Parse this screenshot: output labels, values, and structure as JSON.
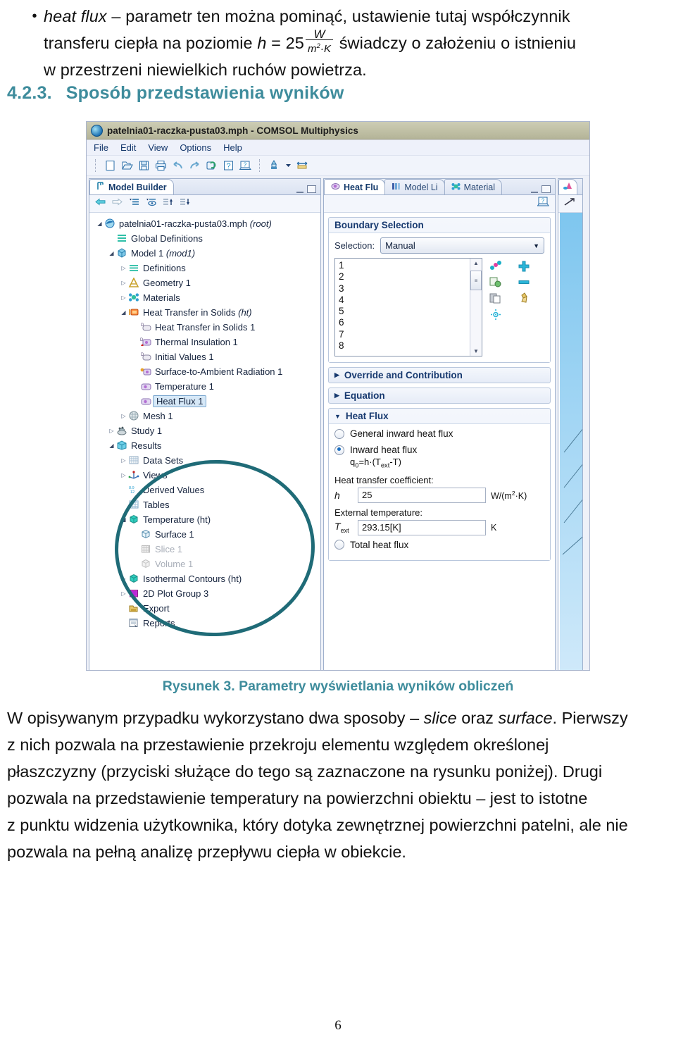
{
  "bullet": {
    "marker": "•",
    "line1_a": "heat flux",
    "line1_b": "– parametr ten można pominąć, ustawienie tutaj współczynnik",
    "line2_pre": "transferu   ciepła   na   poziomie",
    "line2_h": "h",
    "line2_eq": "= 25",
    "frac_num": "W",
    "frac_den_m": "m",
    "frac_den_exp": "2",
    "frac_den_k": "·K",
    "line2_post": "świadczy   o   założeniu   o   istnieniu",
    "line3": "w przestrzeni niewielkich ruchów powietrza."
  },
  "heading": {
    "number": "4.2.3.",
    "text": "Sposób przedstawienia wyników",
    "color": "#3e8c9c"
  },
  "comsol": {
    "title": "patelnia01-raczka-pusta03.mph - COMSOL Multiphysics",
    "menu": [
      "File",
      "Edit",
      "View",
      "Options",
      "Help"
    ],
    "toolbar_icons": [
      "new-icon",
      "open-icon",
      "save-icon",
      "print-icon",
      "undo-icon",
      "redo-icon",
      "refresh-icon",
      "help-icon",
      "help-window-icon",
      "brush-icon",
      "chevron-down-icon",
      "measure-icon"
    ],
    "model_builder": {
      "tab_label": "Model Builder",
      "tool_icons": [
        "back-arrow-icon",
        "forward-arrow-icon",
        "collapse-list-icon",
        "show-hidden-icon",
        "move-up-icon",
        "move-down-icon"
      ],
      "tree": [
        {
          "label": "patelnia01-raczka-pusta03.mph",
          "suffix": "(root)",
          "indent": 0,
          "twisty": "down",
          "icon": "comsol-file-icon"
        },
        {
          "label": "Global Definitions",
          "suffix": "",
          "indent": 1,
          "twisty": "none",
          "icon": "global-definitions-icon"
        },
        {
          "label": "Model 1",
          "suffix": "(mod1)",
          "indent": 1,
          "twisty": "down",
          "icon": "model-icon"
        },
        {
          "label": "Definitions",
          "suffix": "",
          "indent": 2,
          "twisty": "right",
          "icon": "definitions-icon"
        },
        {
          "label": "Geometry 1",
          "suffix": "",
          "indent": 2,
          "twisty": "right",
          "icon": "geometry-icon"
        },
        {
          "label": "Materials",
          "suffix": "",
          "indent": 2,
          "twisty": "right",
          "icon": "materials-icon"
        },
        {
          "label": "Heat Transfer in Solids",
          "suffix": "(ht)",
          "indent": 2,
          "twisty": "down",
          "icon": "heat-transfer-icon"
        },
        {
          "label": "Heat Transfer in Solids 1",
          "suffix": "",
          "indent": 3,
          "twisty": "none",
          "icon": "domain-node-icon"
        },
        {
          "label": "Thermal Insulation 1",
          "suffix": "",
          "indent": 3,
          "twisty": "none",
          "icon": "thermal-insulation-icon"
        },
        {
          "label": "Initial Values 1",
          "suffix": "",
          "indent": 3,
          "twisty": "none",
          "icon": "initial-values-icon"
        },
        {
          "label": "Surface-to-Ambient Radiation 1",
          "suffix": "",
          "indent": 3,
          "twisty": "none",
          "icon": "radiation-icon"
        },
        {
          "label": "Temperature 1",
          "suffix": "",
          "indent": 3,
          "twisty": "none",
          "icon": "temperature-bc-icon"
        },
        {
          "label": "Heat Flux 1",
          "suffix": "",
          "indent": 3,
          "twisty": "none",
          "icon": "heat-flux-icon",
          "selected": true
        },
        {
          "label": "Mesh 1",
          "suffix": "",
          "indent": 2,
          "twisty": "right",
          "icon": "mesh-icon"
        },
        {
          "label": "Study 1",
          "suffix": "",
          "indent": 1,
          "twisty": "right",
          "icon": "study-icon"
        },
        {
          "label": "Results",
          "suffix": "",
          "indent": 1,
          "twisty": "down",
          "icon": "results-icon"
        },
        {
          "label": "Data Sets",
          "suffix": "",
          "indent": 2,
          "twisty": "right",
          "icon": "data-sets-icon"
        },
        {
          "label": "Views",
          "suffix": "",
          "indent": 2,
          "twisty": "right",
          "icon": "views-icon"
        },
        {
          "label": "Derived Values",
          "suffix": "",
          "indent": 2,
          "twisty": "none",
          "icon": "derived-values-icon"
        },
        {
          "label": "Tables",
          "suffix": "",
          "indent": 2,
          "twisty": "none",
          "icon": "tables-icon"
        },
        {
          "label": "Temperature (ht)",
          "suffix": "",
          "indent": 2,
          "twisty": "down",
          "icon": "plot-group-icon"
        },
        {
          "label": "Surface 1",
          "suffix": "",
          "indent": 3,
          "twisty": "none",
          "icon": "surface-plot-icon"
        },
        {
          "label": "Slice 1",
          "suffix": "",
          "indent": 3,
          "twisty": "none",
          "icon": "slice-plot-icon",
          "dim": true
        },
        {
          "label": "Volume 1",
          "suffix": "",
          "indent": 3,
          "twisty": "none",
          "icon": "volume-plot-icon",
          "dim": true
        },
        {
          "label": "Isothermal Contours (ht)",
          "suffix": "",
          "indent": 2,
          "twisty": "right",
          "icon": "plot-group-icon"
        },
        {
          "label": "2D Plot Group 3",
          "suffix": "",
          "indent": 2,
          "twisty": "right",
          "icon": "plot-group-2d-icon"
        },
        {
          "label": "Export",
          "suffix": "",
          "indent": 2,
          "twisty": "none",
          "icon": "export-icon"
        },
        {
          "label": "Reports",
          "suffix": "",
          "indent": 2,
          "twisty": "none",
          "icon": "reports-icon"
        }
      ]
    },
    "settings": {
      "tabs": [
        {
          "label": "Heat Flu",
          "icon": "heat-flux-icon",
          "active": true
        },
        {
          "label": "Model Li",
          "icon": "model-library-icon",
          "active": false
        },
        {
          "label": "Material",
          "icon": "materials-icon",
          "active": false
        }
      ],
      "boundary_selection": {
        "title": "Boundary Selection",
        "selection_label": "Selection:",
        "selection_value": "Manual",
        "list_items": [
          "1",
          "2",
          "3",
          "4",
          "5",
          "6",
          "7",
          "8"
        ],
        "side_icons": [
          "active-selection-icon",
          "add-icon",
          "paste-copy-icon",
          "remove-icon",
          "paste-icon",
          "clear-icon",
          "zoom-selection-icon"
        ]
      },
      "override": {
        "title": "Override and Contribution"
      },
      "equation": {
        "title": "Equation"
      },
      "heat_flux": {
        "title": "Heat Flux",
        "opt_general": "General inward heat flux",
        "opt_inward": "Inward heat flux",
        "opt_total": "Total heat flux",
        "selected_option": "Inward heat flux",
        "equation": "q0=h·(Text-T)",
        "htc_label": "Heat transfer coefficient:",
        "htc_symbol": "h",
        "htc_value": "25",
        "htc_unit_pre": "W/(m",
        "htc_unit_sup": "2",
        "htc_unit_post": "·K)",
        "ext_label": "External temperature:",
        "ext_symbol": "T",
        "ext_symbol_sub": "ext",
        "ext_value": "293.15[K]",
        "ext_unit": "K"
      }
    },
    "graphics": {
      "tool_icons": [
        "graphics-icon",
        "hide-geometry-icon"
      ]
    },
    "annotation": {
      "shape": "ellipse",
      "color": "#1f6b77"
    }
  },
  "caption": {
    "text": "Rysunek 3. Parametry wyświetlania wyników obliczeń",
    "color": "#3e8c9c"
  },
  "paragraph": {
    "l1_a": "W  opisywanym  przypadku  wykorzystano  dwa  sposoby  –",
    "l1_i1": "slice",
    "l1_b": "oraz",
    "l1_i2": "surface",
    "l1_c": ". Pierwszy",
    "l2": "z nich   pozwala   na   przestawienie   przekroju   elementu   względem   określonej",
    "l3": "płaszczyzny  (przyciski  służące  do  tego  są  zaznaczone  na  rysunku  poniżej).  Drugi",
    "l4": "pozwala  na  przedstawienie  temperatury  na  powierzchni  obiektu  –  jest  to  istotne",
    "l5": "z punktu widzenia użytkownika, który dotyka zewnętrznej powierzchni patelni, ale nie",
    "l6": "pozwala na pełną analizę przepływu ciepła w obiekcie."
  },
  "page_number": "6"
}
